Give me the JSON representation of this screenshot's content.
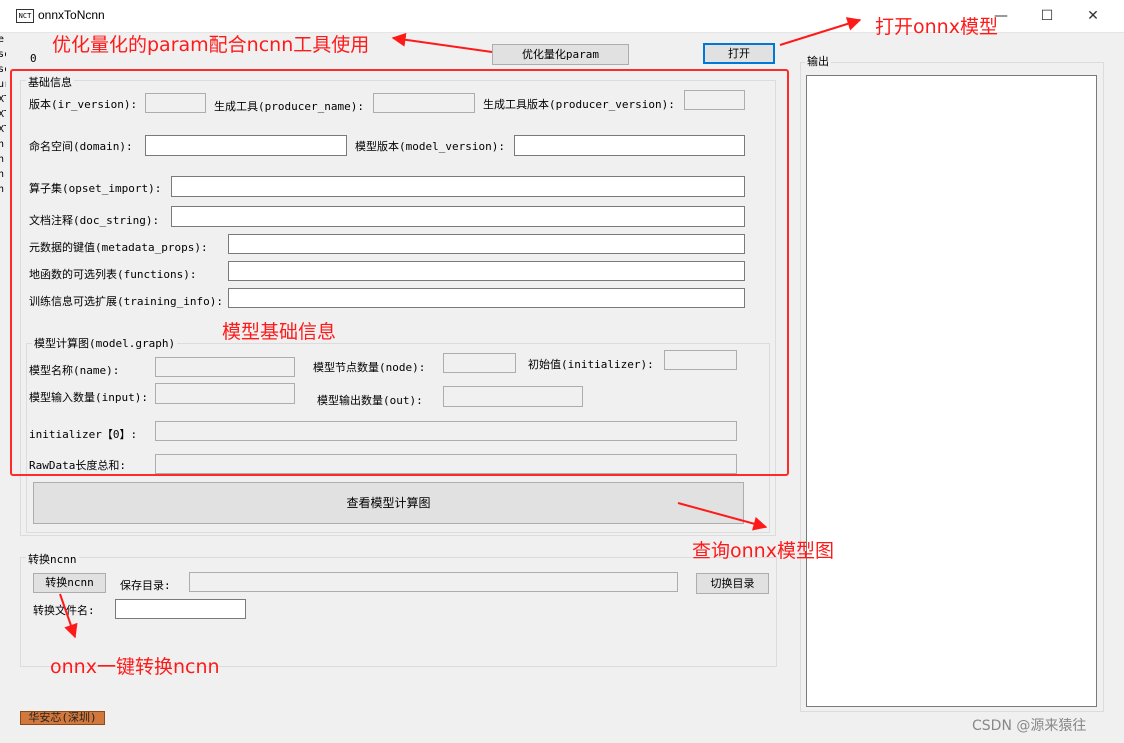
{
  "window": {
    "title": "onnxToNcnn",
    "icon": "app-icon",
    "icon_text": "NCT",
    "controls": {
      "minimize": "—",
      "maximize": "☐",
      "close": "✕"
    }
  },
  "left_strip": [
    "e",
    "sc",
    "sc",
    "ur",
    "XT",
    "XT",
    "XT",
    "n.",
    "n.",
    "n.",
    "n."
  ],
  "top": {
    "counter": "0",
    "optimize_button": "优化量化param",
    "open_button": "打开"
  },
  "output": {
    "label": "输出"
  },
  "basic_info": {
    "group_title": "基础信息",
    "ir_version_label": "版本(ir_version):",
    "producer_name_label": "生成工具(producer_name):",
    "producer_version_label": "生成工具版本(producer_version):",
    "domain_label": "命名空间(domain):",
    "model_version_label": "模型版本(model_version):",
    "opset_import_label": "算子集(opset_import):",
    "doc_string_label": "文档注释(doc_string):",
    "metadata_props_label": "元数据的键值(metadata_props):",
    "functions_label": "地函数的可选列表(functions):",
    "training_info_label": "训练信息可选扩展(training_info):"
  },
  "graph": {
    "group_title": "模型计算图(model.graph)",
    "name_label": "模型名称(name):",
    "node_label": "模型节点数量(node):",
    "initializer_label": "初始值(initializer):",
    "input_label": "模型输入数量(input):",
    "out_label": "模型输出数量(out):",
    "initializer0_label": "initializer【0】:",
    "rawdata_label": "RawData长度总和:",
    "view_button": "查看模型计算图"
  },
  "convert": {
    "group_title": "转换ncnn",
    "convert_button": "转换ncnn",
    "save_dir_label": "保存目录:",
    "switch_dir_button": "切换目录",
    "filename_label": "转换文件名:"
  },
  "footer": {
    "badge": "华安芯(深圳)",
    "watermark": "CSDN @源来猿往"
  },
  "annotations": {
    "optimize_note": "优化量化的param配合ncnn工具使用",
    "open_note": "打开onnx模型",
    "basic_info_note": "模型基础信息",
    "view_graph_note": "查询onnx模型图",
    "convert_note": "onnx一键转换ncnn"
  },
  "colors": {
    "annotation": "#ff1a1a",
    "focus": "#0078d7",
    "badge": "#d2783c"
  }
}
